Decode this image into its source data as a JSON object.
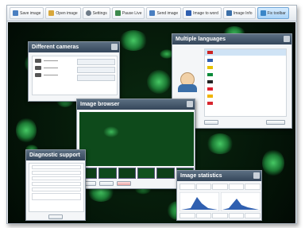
{
  "toolbar": {
    "buttons": [
      {
        "label": "Save image",
        "icon": "save-icon",
        "color": "#4a7fc1"
      },
      {
        "label": "Open image",
        "icon": "folder-icon",
        "color": "#d8a73c"
      },
      {
        "label": "Settings",
        "icon": "gear-icon",
        "color": "#6e7b88"
      },
      {
        "label": "Pause Live",
        "icon": "pause-icon",
        "color": "#3d8a4d"
      },
      {
        "label": "Send image",
        "icon": "send-icon",
        "color": "#4a7fc1"
      },
      {
        "label": "Image to word",
        "icon": "word-icon",
        "color": "#2f5fb0"
      },
      {
        "label": "Image Info",
        "icon": "info-icon",
        "color": "#3b6fa8"
      },
      {
        "label": "Fix toolbar",
        "icon": "pin-icon",
        "color": "#3a86c8"
      }
    ]
  },
  "windows": {
    "cameras": {
      "title": "Different cameras",
      "items": [
        "",
        "",
        ""
      ]
    },
    "languages": {
      "title": "Multiple languages"
    },
    "browser": {
      "title": "Image browser"
    },
    "diagnostic": {
      "title": "Diagnostic support"
    },
    "statistics": {
      "title": "Image statistics"
    }
  },
  "colors": {
    "title_bar": "#34465a",
    "accent": "#3a86c8"
  }
}
